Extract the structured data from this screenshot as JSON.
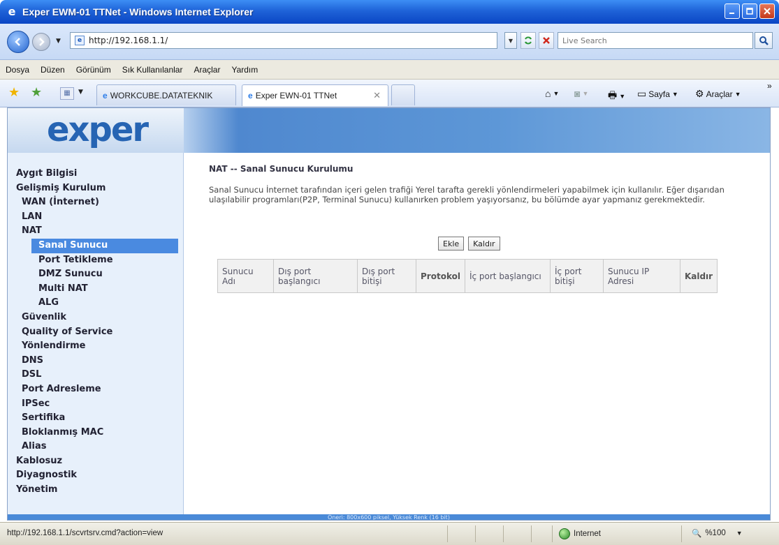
{
  "window": {
    "title": "Exper EWM-01 TTNet - Windows Internet Explorer"
  },
  "address_bar": {
    "url": "http://192.168.1.1/",
    "search_placeholder": "Live Search"
  },
  "menu": [
    "Dosya",
    "Düzen",
    "Görünüm",
    "Sık Kullanılanlar",
    "Araçlar",
    "Yardım"
  ],
  "tabs": {
    "inactive_label": "WORKCUBE.DATATEKNIK",
    "active_label": "Exper EWN-01 TTNet"
  },
  "command_bar": {
    "page_label": "Sayfa",
    "tools_label": "Araçlar"
  },
  "logo_text": "exper",
  "sidebar": {
    "items": [
      {
        "label": "Aygıt Bilgisi",
        "level": 0
      },
      {
        "label": "Gelişmiş Kurulum",
        "level": 0
      },
      {
        "label": "WAN (İnternet)",
        "level": 1
      },
      {
        "label": "LAN",
        "level": 1
      },
      {
        "label": "NAT",
        "level": 1
      },
      {
        "label": "Sanal Sunucu",
        "level": 2,
        "selected": true
      },
      {
        "label": "Port Tetikleme",
        "level": 2
      },
      {
        "label": "DMZ Sunucu",
        "level": 2
      },
      {
        "label": "Multi NAT",
        "level": 2
      },
      {
        "label": "ALG",
        "level": 2
      },
      {
        "label": "Güvenlik",
        "level": 1
      },
      {
        "label": "Quality of Service",
        "level": 1
      },
      {
        "label": "Yönlendirme",
        "level": 1
      },
      {
        "label": "DNS",
        "level": 1
      },
      {
        "label": "DSL",
        "level": 1
      },
      {
        "label": "Port Adresleme",
        "level": 1
      },
      {
        "label": "IPSec",
        "level": 1
      },
      {
        "label": "Sertifika",
        "level": 1
      },
      {
        "label": "Bloklanmış MAC",
        "level": 1
      },
      {
        "label": "Alias",
        "level": 1
      },
      {
        "label": "Kablosuz",
        "level": 0
      },
      {
        "label": "Diyagnostik",
        "level": 0
      },
      {
        "label": "Yönetim",
        "level": 0
      }
    ]
  },
  "main": {
    "title": "NAT -- Sanal Sunucu Kurulumu",
    "description": "Sanal Sunucu İnternet tarafından içeri gelen trafiği Yerel tarafta gerekli yönlendirmeleri yapabilmek için kullanılır. Eğer dışarıdan ulaşılabilir programları(P2P, Terminal Sunucu) kullanırken problem yaşıyorsanız, bu bölümde ayar yapmanız gerekmektedir.",
    "add_button": "Ekle",
    "remove_button": "Kaldır",
    "table_headers": [
      "Sunucu Adı",
      "Dış port başlangıcı",
      "Dış port bitişi",
      "Protokol",
      "İç port başlangıcı",
      "İç port bitişi",
      "Sunucu IP Adresi",
      "Kaldır"
    ]
  },
  "footer_note": "Öneri: 800x600 piksel, Yüksek Renk (16 bit)",
  "status_bar": {
    "url": "http://192.168.1.1/scvrtsrv.cmd?action=view",
    "zone": "Internet",
    "zoom": "%100"
  }
}
